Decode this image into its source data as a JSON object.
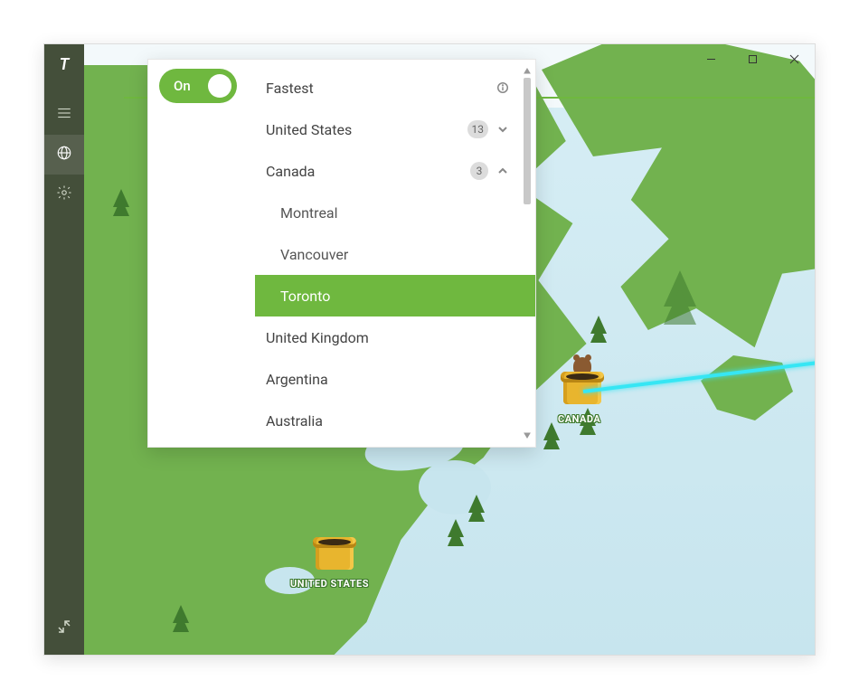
{
  "colors": {
    "accent": "#6fb83f",
    "sidebar": "#444f3a",
    "water": "#c7e5ee",
    "land": "#72b24f",
    "beam": "#36e6f4"
  },
  "window_controls": {
    "minimize": "minimize",
    "maximize": "maximize",
    "close": "close"
  },
  "sidebar": {
    "logo_text": "T",
    "items": [
      {
        "id": "menu",
        "icon": "menu-icon",
        "active": false
      },
      {
        "id": "globe",
        "icon": "globe-icon",
        "active": true
      },
      {
        "id": "settings",
        "icon": "gear-icon",
        "active": false
      }
    ],
    "collapse_icon": "collapse-icon"
  },
  "toggle": {
    "label": "On",
    "state": true
  },
  "locations": {
    "fastest": {
      "label": "Fastest",
      "info": true
    },
    "countries": [
      {
        "label": "United States",
        "count": 13,
        "expanded": false
      },
      {
        "label": "Canada",
        "count": 3,
        "expanded": true,
        "cities": [
          {
            "label": "Montreal",
            "selected": false
          },
          {
            "label": "Vancouver",
            "selected": false
          },
          {
            "label": "Toronto",
            "selected": true
          }
        ]
      },
      {
        "label": "United Kingdom"
      },
      {
        "label": "Argentina"
      },
      {
        "label": "Australia"
      }
    ]
  },
  "map": {
    "labels": {
      "canada": "CANADA",
      "united_states": "UNITED STATES"
    },
    "connected_to": "Canada"
  }
}
